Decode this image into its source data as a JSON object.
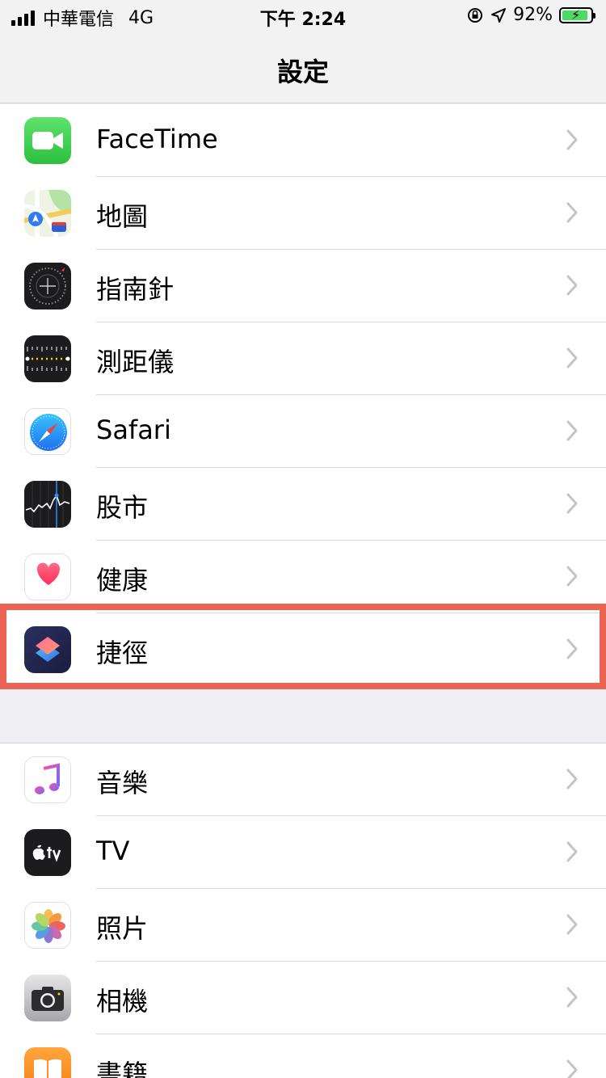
{
  "status_bar": {
    "carrier": "中華電信",
    "network": "4G",
    "time": "下午 2:24",
    "battery_percent": "92%",
    "battery_level": 0.92
  },
  "nav": {
    "title": "設定"
  },
  "group1": [
    {
      "label": "FaceTime",
      "icon": "facetime-icon"
    },
    {
      "label": "地圖",
      "icon": "maps-icon"
    },
    {
      "label": "指南針",
      "icon": "compass-icon"
    },
    {
      "label": "測距儀",
      "icon": "measure-icon"
    },
    {
      "label": "Safari",
      "icon": "safari-icon"
    },
    {
      "label": "股市",
      "icon": "stocks-icon"
    },
    {
      "label": "健康",
      "icon": "health-icon"
    },
    {
      "label": "捷徑",
      "icon": "shortcuts-icon"
    }
  ],
  "group2": [
    {
      "label": "音樂",
      "icon": "music-icon"
    },
    {
      "label": "TV",
      "icon": "tv-icon"
    },
    {
      "label": "照片",
      "icon": "photos-icon"
    },
    {
      "label": "相機",
      "icon": "camera-icon"
    },
    {
      "label": "書籍",
      "icon": "books-icon"
    }
  ],
  "colors": {
    "highlight": "#ec6354",
    "accent_green": "#4cd964"
  }
}
